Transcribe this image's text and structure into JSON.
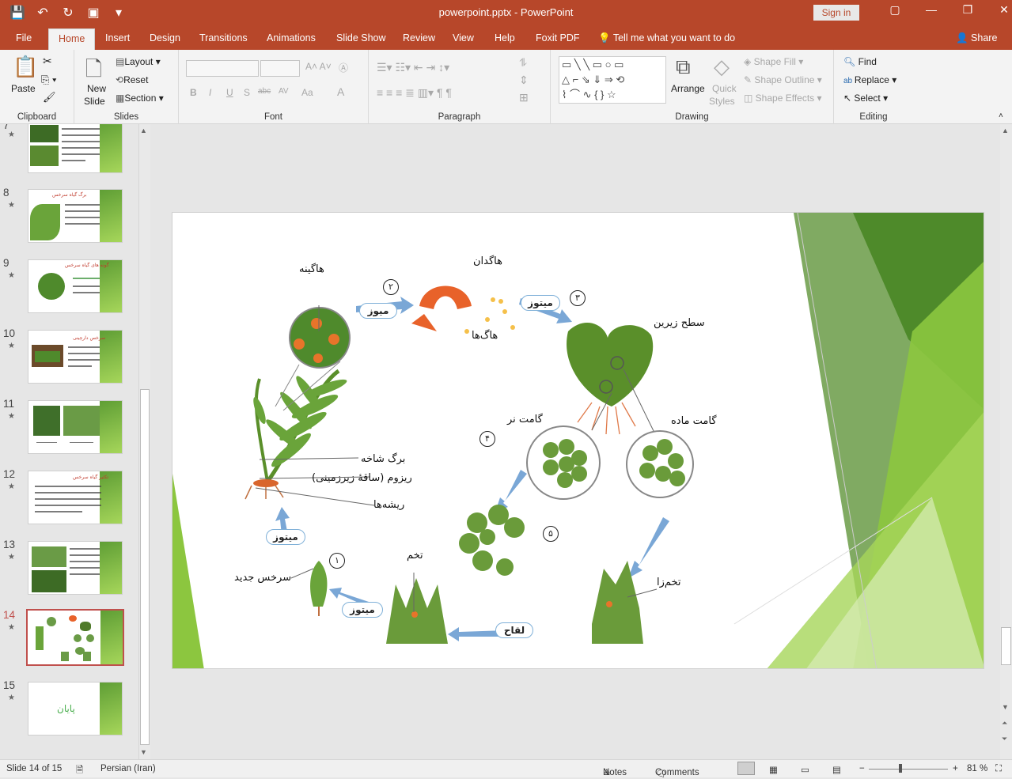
{
  "window": {
    "doc_title": "powerpoint.pptx  -  PowerPoint",
    "sign_in": "Sign in",
    "min": "—",
    "restore": "❐",
    "close": "✕",
    "ribbon_display": "▢"
  },
  "qat": {
    "save": "💾",
    "undo": "↶",
    "redo": "↻",
    "present": "▣",
    "more": "▾"
  },
  "tabs": [
    "File",
    "Home",
    "Insert",
    "Design",
    "Transitions",
    "Animations",
    "Slide Show",
    "Review",
    "View",
    "Help",
    "Foxit PDF"
  ],
  "tell_me": "Tell me what you want to do",
  "share": "Share",
  "ribbon": {
    "clipboard": {
      "label": "Clipboard",
      "paste": "Paste"
    },
    "slides": {
      "label": "Slides",
      "new_slide": "New",
      "new_slide2": "Slide",
      "layout": "Layout",
      "reset": "Reset",
      "section": "Section"
    },
    "font": {
      "label": "Font",
      "bold": "B",
      "italic": "I",
      "underline": "U",
      "shadow": "S",
      "strike": "abc",
      "spacing": "AV",
      "case": "Aa",
      "color": "A"
    },
    "paragraph": {
      "label": "Paragraph"
    },
    "drawing": {
      "label": "Drawing",
      "arrange": "Arrange",
      "quick_styles": "Quick",
      "quick_styles2": "Styles",
      "shape_fill": "Shape Fill",
      "shape_outline": "Shape Outline",
      "shape_effects": "Shape Effects"
    },
    "editing": {
      "label": "Editing",
      "find": "Find",
      "replace": "Replace",
      "select": "Select"
    }
  },
  "thumbnails": [
    {
      "num": "7",
      "title": ""
    },
    {
      "num": "8",
      "title": "برگ گیاه سرخس"
    },
    {
      "num": "9",
      "title": "گونه های گیاه سرخس"
    },
    {
      "num": "10",
      "title": "سرخس دارچینی"
    },
    {
      "num": "11",
      "title": ""
    },
    {
      "num": "12",
      "title": "تکثیر گیاه سرخس"
    },
    {
      "num": "13",
      "title": ""
    },
    {
      "num": "14",
      "title": ""
    },
    {
      "num": "15",
      "title": "پایان"
    }
  ],
  "diagram": {
    "hagineh": "هاگینه",
    "hagdan": "هاگدان",
    "hagha": "هاگ‌ها",
    "satheh": "سطح زیرین",
    "gamet_nar": "گامت نر",
    "gamet_madeh": "گامت ماده",
    "barg": "برگ شاخه",
    "rizom": "ریزوم (ساقهٔ زیرزمینی)",
    "risheh": "ریشه‌ها",
    "sorkhas": "سرخس جدید",
    "tokhm": "تخم",
    "tokhmza": "تخم‌زا",
    "meioz": "میوز",
    "mitoz1": "میتوز",
    "mitoz2": "میتوز",
    "mitoz3": "میتوز",
    "leghah": "لقاح",
    "n1": "۱",
    "n2": "۲",
    "n3": "۳",
    "n4": "۴",
    "n5": "۵"
  },
  "status": {
    "slide_info": "Slide 14 of 15",
    "language": "Persian (Iran)",
    "notes": "Notes",
    "comments": "Comments",
    "zoom": "81 %",
    "minus": "−",
    "plus": "+"
  },
  "colors": {
    "accent": "#b7472a",
    "green_dark": "#4e8a2a",
    "green_light": "#a6d65a"
  }
}
